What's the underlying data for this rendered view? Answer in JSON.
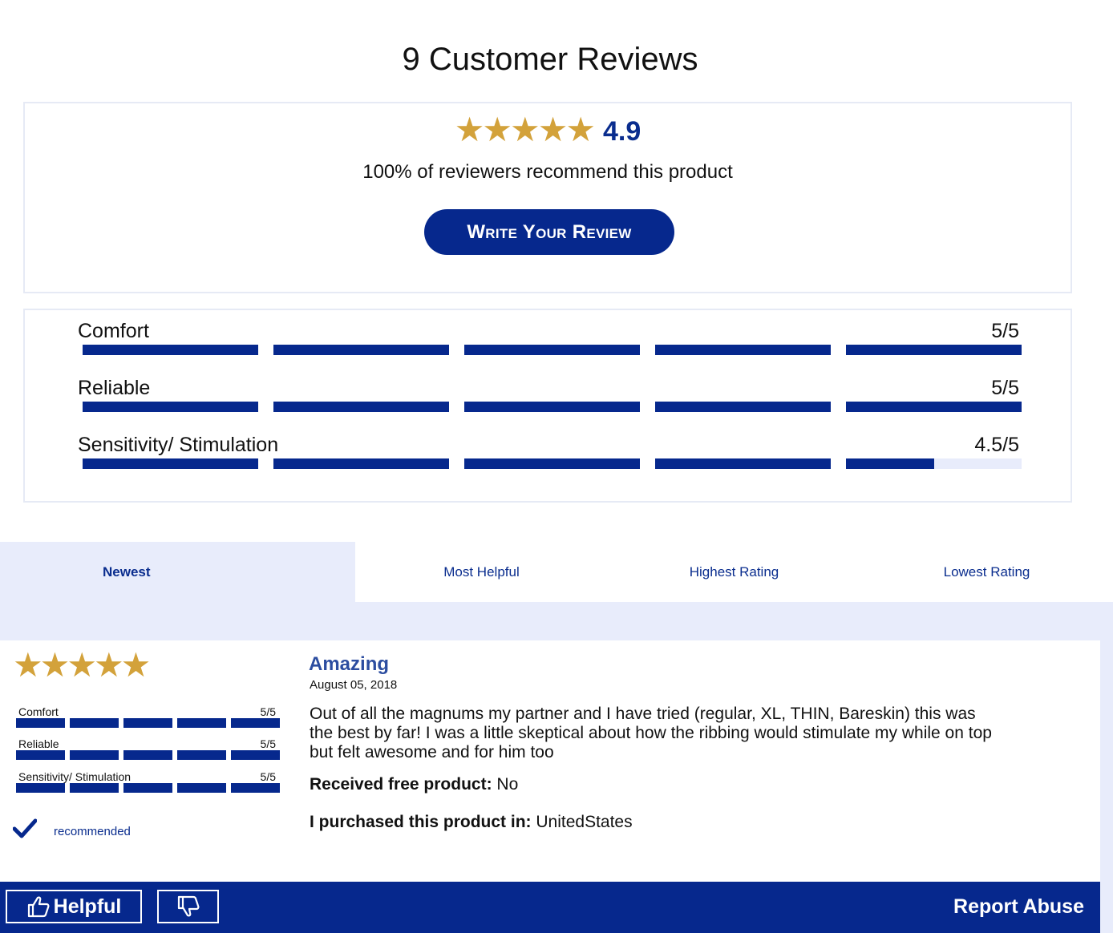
{
  "header": {
    "title": "9 Customer Reviews"
  },
  "summary": {
    "stars": 5,
    "average_rating": "4.9",
    "recommend_text": "100% of reviewers recommend this product",
    "write_review_label": "Write Your Review"
  },
  "attributes": [
    {
      "name": "Comfort",
      "score": "5/5",
      "value": 5
    },
    {
      "name": "Reliable",
      "score": "5/5",
      "value": 5
    },
    {
      "name": "Sensitivity/ Stimulation",
      "score": "4.5/5",
      "value": 4.5
    }
  ],
  "sort_tabs": [
    "Newest",
    "Most Helpful",
    "Highest Rating",
    "Lowest Rating"
  ],
  "active_sort": "Newest",
  "review": {
    "stars": 5,
    "title": "Amazing",
    "date": "August 05, 2018",
    "body": "Out of all the magnums my partner and I have tried (regular, XL, THIN, Bareskin) this was the best by far! I was a little skeptical about how the ribbing would stimulate my while on top but felt awesome and for him too",
    "attributes": [
      {
        "name": "Comfort",
        "score": "5/5",
        "value": 5
      },
      {
        "name": "Reliable",
        "score": "5/5",
        "value": 5
      },
      {
        "name": "Sensitivity/ Stimulation",
        "score": "5/5",
        "value": 5
      }
    ],
    "recommended_label": "recommended",
    "free_product_label": "Received free product:",
    "free_product_value": "No",
    "purchased_in_label": "I purchased this product in:",
    "purchased_in_value": "UnitedStates"
  },
  "actions": {
    "helpful_label": "Helpful",
    "report_abuse_label": "Report Abuse"
  },
  "icons": {
    "star": "star-icon",
    "check": "checkmark-icon",
    "thumbs_up": "thumbs-up-icon",
    "thumbs_down": "thumbs-down-icon"
  },
  "colors": {
    "brand_blue": "#06288d",
    "link_blue": "#0a2d8e",
    "star_gold": "#d3a23b",
    "light_panel": "#e8ecfb"
  }
}
